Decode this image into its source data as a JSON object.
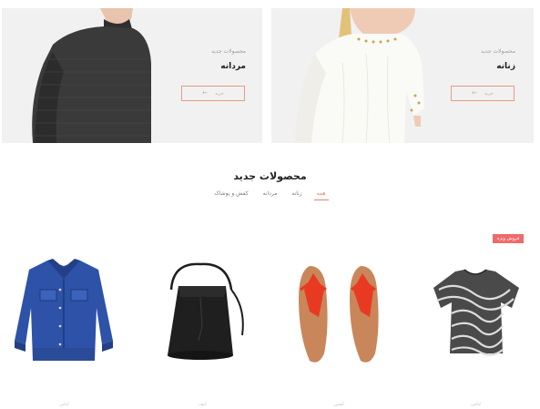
{
  "banners": [
    {
      "id": "men",
      "subtitle": "محصولات جدید",
      "title": "مردانه",
      "button_label": "خرید"
    },
    {
      "id": "women",
      "subtitle": "محصولات جدید",
      "title": "زنانه",
      "button_label": "خرید"
    }
  ],
  "section": {
    "title": "محصولات جدید",
    "tabs": [
      {
        "label": "همه",
        "active": true
      },
      {
        "label": "زنانه",
        "active": false
      },
      {
        "label": "مردانه",
        "active": false
      },
      {
        "label": "کفش و پوشاک",
        "active": false
      }
    ]
  },
  "badge": {
    "label": "فروش ویژه",
    "color": "#ee6a6a"
  },
  "products": [
    {
      "name": "لباس",
      "icon": "denim-jacket"
    },
    {
      "name": "کیف",
      "icon": "leather-bucket-bag"
    },
    {
      "name": "کفش",
      "icon": "red-sandals"
    },
    {
      "name": "لباس",
      "icon": "striped-blouse"
    }
  ],
  "colors": {
    "accent": "#e0826b",
    "button_border": "#e89b87"
  }
}
